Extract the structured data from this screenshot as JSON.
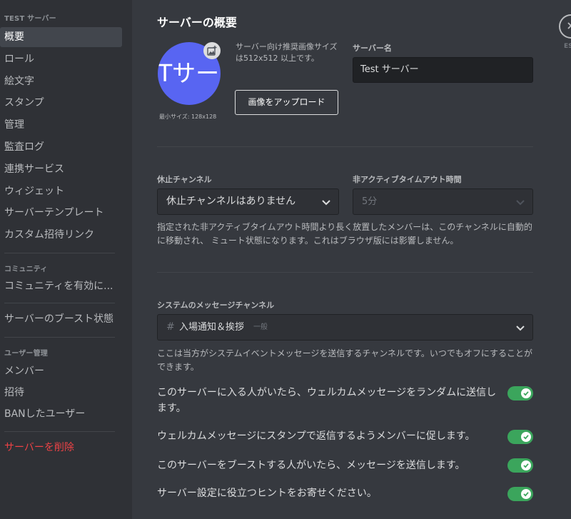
{
  "sidebar": {
    "server_header": "TEST サーバー",
    "items": [
      "概要",
      "ロール",
      "絵文字",
      "スタンプ",
      "管理",
      "監査ログ",
      "連携サービス",
      "ウィジェット",
      "サーバーテンプレート",
      "カスタム招待リンク"
    ],
    "community_header": "コミュニティ",
    "community_item": "コミュニティを有効に...",
    "boost_item": "サーバーのブースト状態",
    "users_header": "ユーザー管理",
    "user_items": [
      "メンバー",
      "招待",
      "BANしたユーザー"
    ],
    "delete_item": "サーバーを削除"
  },
  "main": {
    "title": "サーバーの概要",
    "avatar_text": "Tサー",
    "min_size": "最小サイズ: 128x128",
    "upload_hint": "サーバー向け推奨画像サイズは512x512 以上です。",
    "upload_button": "画像をアップロード",
    "server_name_label": "サーバー名",
    "server_name_value": "Test サーバー",
    "afk_channel_label": "休止チャンネル",
    "afk_channel_value": "休止チャンネルはありません",
    "afk_timeout_label": "非アクティブタイムアウト時間",
    "afk_timeout_value": "5分",
    "afk_note": "指定された非アクティブタイムアウト時間より長く放置したメンバーは、このチャンネルに自動的に移動され、 ミュート状態になります。これはブラウザ版には影響しません。",
    "system_channel_label": "システムのメッセージチャンネル",
    "system_channel_value": "入場通知＆挨拶",
    "system_channel_category": "一般",
    "system_note": "ここは当方がシステムイベントメッセージを送信するチャンネルです。いつでもオフにすることができます。",
    "toggles": [
      {
        "label": "このサーバーに入る人がいたら、ウェルカムメッセージをランダムに送信します。",
        "on": true
      },
      {
        "label": "ウェルカムメッセージにスタンプで返信するようメンバーに促します。",
        "on": true
      },
      {
        "label": "このサーバーをブーストする人がいたら、メッセージを送信します。",
        "on": true
      },
      {
        "label": "サーバー設定に役立つヒントをお寄せください。",
        "on": true
      }
    ],
    "esc_label": "ESC"
  },
  "colors": {
    "background": "#36393f",
    "sidebar": "#2f3136",
    "accent": "#5865f2",
    "toggle_on": "#3ba55c",
    "danger": "#ed4245"
  }
}
